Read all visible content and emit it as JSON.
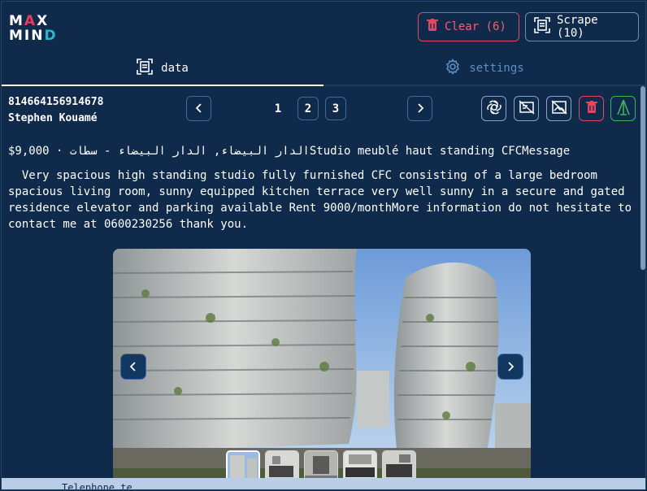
{
  "logo": {
    "line1": [
      "M",
      "A",
      "X"
    ],
    "line2": [
      "M",
      "I",
      "N",
      "D"
    ]
  },
  "header": {
    "clear_label": "Clear (6)",
    "scrape_label": "Scrape (10)"
  },
  "tabs": [
    {
      "label": "data",
      "icon": "scan-icon"
    },
    {
      "label": "settings",
      "icon": "gear-icon"
    }
  ],
  "listing": {
    "id": "814664156914678",
    "author": "Stephen Kouamé",
    "title_line": "$9,000 · الدار البيضاء, الدار البيضاء - سطاتStudio meublé haut standing CFCMessage",
    "description": "  Very spacious high standing studio fully furnished CFC consisting of a large bedroom spacious living room, sunny equipped kitchen terrace very well sunny in a secure and gated residence elevator and parking available Rent 9000/monthMore information do not hesitate to contact me at 0600230256 thank you."
  },
  "pagination": {
    "pages": [
      "1",
      "2",
      "3"
    ],
    "current": "1"
  },
  "actions": [
    "openai-icon",
    "hide-image-icon",
    "no-image-icon",
    "trash-icon",
    "arrow-up-icon"
  ],
  "colors": {
    "background": "#0f2a4a",
    "danger": "#e0485f",
    "success": "#47b05f",
    "accent": "#5f8fc2"
  },
  "bottom_text": "Telephone te"
}
